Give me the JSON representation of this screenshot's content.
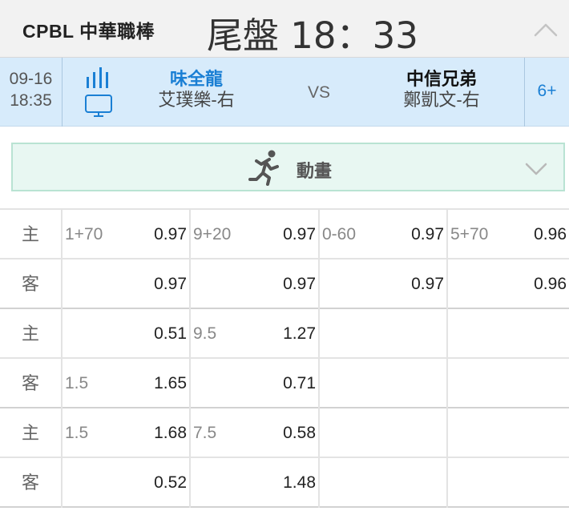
{
  "header": {
    "league": "CPBL 中華職棒",
    "status": "尾盤 18：33",
    "collapse_icon": "chevron-up-icon"
  },
  "match": {
    "date": "09-16",
    "time": "18:35",
    "home": {
      "name": "味全龍",
      "pitcher": "艾璞樂-右"
    },
    "vs": "VS",
    "away": {
      "name": "中信兄弟",
      "pitcher": "鄭凱文-右"
    },
    "more": "6+",
    "colors": {
      "home_name": "#1a7fd4",
      "row_bg": "#d7ebfb"
    }
  },
  "animation": {
    "label": "動畫",
    "icon": "runner-icon",
    "expand_icon": "chevron-down-icon"
  },
  "odds": {
    "rows": [
      {
        "side": "主",
        "cells": [
          {
            "line": "1+70",
            "odds": "0.97"
          },
          {
            "line": "9+20",
            "odds": "0.97"
          },
          {
            "line": "0-60",
            "odds": "0.97"
          },
          {
            "line": "5+70",
            "odds": "0.96"
          }
        ]
      },
      {
        "side": "客",
        "cells": [
          {
            "line": "",
            "odds": "0.97"
          },
          {
            "line": "",
            "odds": "0.97"
          },
          {
            "line": "",
            "odds": "0.97"
          },
          {
            "line": "",
            "odds": "0.96"
          }
        ]
      },
      {
        "side": "主",
        "cells": [
          {
            "line": "",
            "odds": "0.51"
          },
          {
            "line": "9.5",
            "odds": "1.27"
          },
          {
            "line": "",
            "odds": ""
          },
          {
            "line": "",
            "odds": ""
          }
        ]
      },
      {
        "side": "客",
        "cells": [
          {
            "line": "1.5",
            "odds": "1.65"
          },
          {
            "line": "",
            "odds": "0.71"
          },
          {
            "line": "",
            "odds": ""
          },
          {
            "line": "",
            "odds": ""
          }
        ]
      },
      {
        "side": "主",
        "cells": [
          {
            "line": "1.5",
            "odds": "1.68"
          },
          {
            "line": "7.5",
            "odds": "0.58"
          },
          {
            "line": "",
            "odds": ""
          },
          {
            "line": "",
            "odds": ""
          }
        ]
      },
      {
        "side": "客",
        "cells": [
          {
            "line": "",
            "odds": "0.52"
          },
          {
            "line": "",
            "odds": "1.48"
          },
          {
            "line": "",
            "odds": ""
          },
          {
            "line": "",
            "odds": ""
          }
        ]
      }
    ]
  }
}
